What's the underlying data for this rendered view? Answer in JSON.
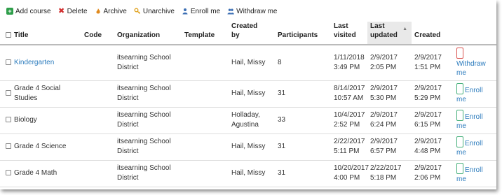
{
  "toolbar": {
    "add_course": "Add course",
    "delete": "Delete",
    "archive": "Archive",
    "unarchive": "Unarchive",
    "enroll_me": "Enroll me",
    "withdraw_me": "Withdraw me"
  },
  "headers": {
    "title": "Title",
    "code": "Code",
    "organization": "Organization",
    "template": "Template",
    "created_by_1": "Created",
    "created_by_2": "by",
    "participants": "Participants",
    "last_visited_1": "Last",
    "last_visited_2": "visited",
    "last_updated_1": "Last",
    "last_updated_2": "updated",
    "created": "Created"
  },
  "rows": [
    {
      "title": "Kindergarten",
      "code": "",
      "org1": "itsearning School",
      "org2": "District",
      "template": "",
      "created_by1": "Hail, Missy",
      "created_by2": "",
      "participants": "8",
      "visited1": "1/11/2018",
      "visited2": "3:49 PM",
      "updated1": "2/9/2017",
      "updated2": "2:05 PM",
      "created1": "2/9/2017",
      "created2": "1:51 PM",
      "action1": "Withdraw",
      "action2": "me"
    },
    {
      "title": "Grade 4 Social Studies",
      "code": "",
      "org1": "itsearning School",
      "org2": "District",
      "template": "",
      "created_by1": "Hail, Missy",
      "created_by2": "",
      "participants": "31",
      "visited1": "8/14/2017",
      "visited2": "10:57 AM",
      "updated1": "2/9/2017",
      "updated2": "5:30 PM",
      "created1": "2/9/2017",
      "created2": "5:29 PM",
      "action1": "Enroll",
      "action2": "me"
    },
    {
      "title": "Biology",
      "code": "",
      "org1": "itsearning School",
      "org2": "District",
      "template": "",
      "created_by1": "Holladay,",
      "created_by2": "Agustina",
      "participants": "33",
      "visited1": "10/4/2017",
      "visited2": "2:52 PM",
      "updated1": "2/9/2017",
      "updated2": "6:24 PM",
      "created1": "2/9/2017",
      "created2": "6:15 PM",
      "action1": "Enroll",
      "action2": "me"
    },
    {
      "title": "Grade 4 Science",
      "code": "",
      "org1": "itsearning School",
      "org2": "District",
      "template": "",
      "created_by1": "Hail, Missy",
      "created_by2": "",
      "participants": "31",
      "visited1": "2/22/2017",
      "visited2": "5:11 PM",
      "updated1": "2/9/2017",
      "updated2": "6:57 PM",
      "created1": "2/9/2017",
      "created2": "4:48 PM",
      "action1": "Enroll",
      "action2": "me"
    },
    {
      "title": "Grade 4 Math",
      "code": "",
      "org1": "itsearning School",
      "org2": "District",
      "template": "",
      "created_by1": "Hail, Missy",
      "created_by2": "",
      "participants": "31",
      "visited1": "10/20/2017",
      "visited2": "4:00 PM",
      "updated1": "2/22/2017",
      "updated2": "5:18 PM",
      "created1": "2/9/2017",
      "created2": "2:06 PM",
      "action1": "Enroll",
      "action2": "me"
    }
  ],
  "colors": {
    "link": "#2b7bbd",
    "add_icon": "#2e9e4a",
    "delete_icon": "#d12f2f",
    "withdraw_border": "#d9534f",
    "enroll_border": "#46b07a",
    "sorted_header_bg": "#e9e9e9"
  },
  "icons": {
    "add": "plus-square-icon",
    "delete": "x-icon",
    "archive": "flame-icon",
    "unarchive": "key-icon",
    "enroll": "person-icon",
    "withdraw": "people-icon"
  }
}
